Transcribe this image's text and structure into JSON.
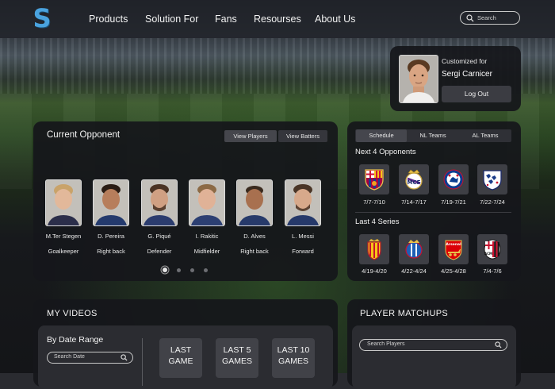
{
  "nav": {
    "logo_letter": "S",
    "items": [
      "Products",
      "Solution For",
      "Fans",
      "Resourses",
      "About Us"
    ],
    "search_placeholder": "Search"
  },
  "profile": {
    "customized_label": "Customized for",
    "name": "Sergi Carnicer",
    "logout_label": "Log Out"
  },
  "opponent": {
    "title": "Current Opponent",
    "view_players_label": "View Players",
    "view_batters_label": "View Batters",
    "players": [
      {
        "name": "M.Ter Stegen",
        "position": "Goalkeeper"
      },
      {
        "name": "D. Pereira",
        "position": "Right back"
      },
      {
        "name": "G. Piqué",
        "position": "Defender"
      },
      {
        "name": "I. Rakitic",
        "position": "Midfielder"
      },
      {
        "name": "D. Alves",
        "position": "Right back"
      },
      {
        "name": "L. Messi",
        "position": "Forward"
      }
    ],
    "pages": 4,
    "active_page": 1
  },
  "schedule": {
    "tabs": [
      "Schedule",
      "NL Teams",
      "AL Teams"
    ],
    "active_tab": "Schedule",
    "next_title": "Next 4 Opponents",
    "next": [
      {
        "crest": "barcelona-crest-icon",
        "date": "7/7-7/10"
      },
      {
        "crest": "real-madrid-crest-icon",
        "date": "7/14-7/17"
      },
      {
        "crest": "chelsea-crest-icon",
        "date": "7/19-7/21"
      },
      {
        "crest": "england-crest-icon",
        "date": "7/22-7/24"
      }
    ],
    "last_title": "Last 4 Series",
    "last": [
      {
        "crest": "mallorca-crest-icon",
        "date": "4/19-4/20"
      },
      {
        "crest": "espanyol-crest-icon",
        "date": "4/22-4/24"
      },
      {
        "crest": "arsenal-crest-icon",
        "date": "4/25-4/28"
      },
      {
        "crest": "ac-milan-crest-icon",
        "date": "7/4-7/6"
      }
    ]
  },
  "videos": {
    "title": "MY VIDEOS",
    "range_title": "By Date Range",
    "date_placeholder": "Search Date",
    "buttons": [
      {
        "line1": "LAST",
        "line2": "GAME"
      },
      {
        "line1": "LAST 5",
        "line2": "GAMES"
      },
      {
        "line1": "LAST 10",
        "line2": "GAMES"
      }
    ]
  },
  "matchups": {
    "title": "PLAYER MATCHUPS",
    "search_placeholder": "Search Players"
  },
  "colors": {
    "logo_blue": "#4aa3df",
    "panel_bg": "#16171b",
    "button_bg": "#3b3c42"
  }
}
